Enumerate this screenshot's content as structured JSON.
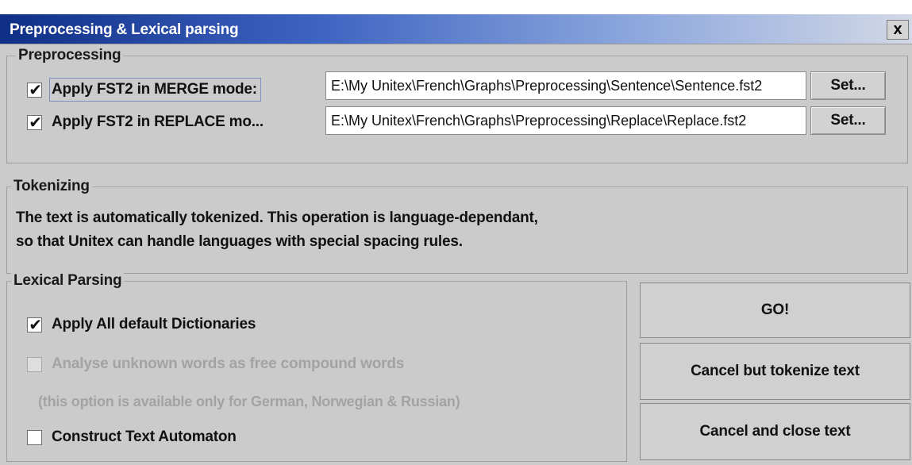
{
  "window": {
    "title": "Preprocessing & Lexical parsing",
    "close_label": "x"
  },
  "preprocessing": {
    "legend": "Preprocessing",
    "merge": {
      "checked": true,
      "label": "Apply FST2 in MERGE mode:",
      "path": "E:\\My Unitex\\French\\Graphs\\Preprocessing\\Sentence\\Sentence.fst2",
      "set_label": "Set..."
    },
    "replace": {
      "checked": true,
      "label": "Apply FST2 in REPLACE mo...",
      "path": "E:\\My Unitex\\French\\Graphs\\Preprocessing\\Replace\\Replace.fst2",
      "set_label": "Set..."
    }
  },
  "tokenizing": {
    "legend": "Tokenizing",
    "line1": "The text is automatically tokenized. This operation is language-dependant,",
    "line2": "so that Unitex can handle languages with special spacing rules."
  },
  "lexical": {
    "legend": "Lexical Parsing",
    "apply_dicts": {
      "checked": true,
      "label": "Apply All default Dictionaries"
    },
    "analyse_unknown": {
      "checked": false,
      "enabled": false,
      "label": "Analyse unknown words as free compound words"
    },
    "note": "(this option is available only for German, Norwegian & Russian)",
    "construct_automaton": {
      "checked": false,
      "label": "Construct Text Automaton"
    }
  },
  "actions": {
    "go": "GO!",
    "cancel_tokenize": "Cancel but tokenize text",
    "cancel_close": "Cancel and close text"
  },
  "glyphs": {
    "check": "✔"
  },
  "colors": {
    "title_start": "#0f2f86",
    "title_end": "#d2d8e6",
    "panel": "#cbcbcb",
    "disabled_text": "#a3a3a3"
  }
}
